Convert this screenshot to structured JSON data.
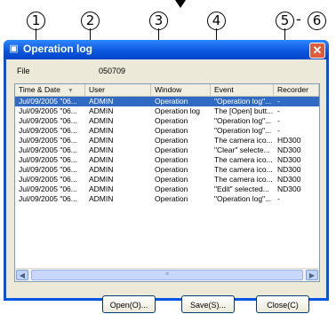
{
  "callouts": [
    "1",
    "2",
    "3",
    "4",
    "5",
    "-",
    "6"
  ],
  "window": {
    "title": "Operation log"
  },
  "file": {
    "label": "File",
    "value": "050709"
  },
  "columns": [
    "Time & Date",
    "User",
    "Window",
    "Event",
    "Recorder"
  ],
  "rows": [
    {
      "time": "Jul/09/2005 \"06...",
      "user": "ADMIN",
      "window": "Operation",
      "event": "\"Operation log\"...",
      "recorder": "-",
      "selected": true
    },
    {
      "time": "Jul/09/2005 \"06...",
      "user": "ADMIN",
      "window": "Operation log",
      "event": "The [Open] butt...",
      "recorder": "-"
    },
    {
      "time": "Jul/09/2005 \"06...",
      "user": "ADMIN",
      "window": "Operation",
      "event": "\"Operation log\"...",
      "recorder": "-"
    },
    {
      "time": "Jul/09/2005 \"06...",
      "user": "ADMIN",
      "window": "Operation",
      "event": "\"Operation log\"...",
      "recorder": "-"
    },
    {
      "time": "Jul/09/2005 \"06...",
      "user": "ADMIN",
      "window": "Operation",
      "event": "The camera ico...",
      "recorder": "HD300"
    },
    {
      "time": "Jul/09/2005 \"06...",
      "user": "ADMIN",
      "window": "Operation",
      "event": "\"Clear\" selecte...",
      "recorder": "ND300"
    },
    {
      "time": "Jul/09/2005 \"06...",
      "user": "ADMIN",
      "window": "Operation",
      "event": "The camera ico...",
      "recorder": "ND300"
    },
    {
      "time": "Jul/09/2005 \"06...",
      "user": "ADMIN",
      "window": "Operation",
      "event": "The camera ico...",
      "recorder": "ND300"
    },
    {
      "time": "Jul/09/2005 \"06...",
      "user": "ADMIN",
      "window": "Operation",
      "event": "The camera ico...",
      "recorder": "ND300"
    },
    {
      "time": "Jul/09/2005 \"06...",
      "user": "ADMIN",
      "window": "Operation",
      "event": "\"Edit\" selected...",
      "recorder": "ND300"
    },
    {
      "time": "Jul/09/2005 \"06...",
      "user": "ADMIN",
      "window": "Operation",
      "event": "\"Operation log\"...",
      "recorder": "-"
    }
  ],
  "buttons": {
    "open": "Open(O)...",
    "save": "Save(S)...",
    "close": "Close(C)"
  },
  "icons": {
    "title": "log-icon",
    "close": "close-icon",
    "sort": "sort-arrow-icon",
    "left": "scroll-left-icon",
    "right": "scroll-right-icon",
    "thumb": "scroll-thumb-grip-icon"
  },
  "colors": {
    "title_bar": "#0a55dd",
    "selection": "#316ac5",
    "close_button": "#e25a3c"
  }
}
